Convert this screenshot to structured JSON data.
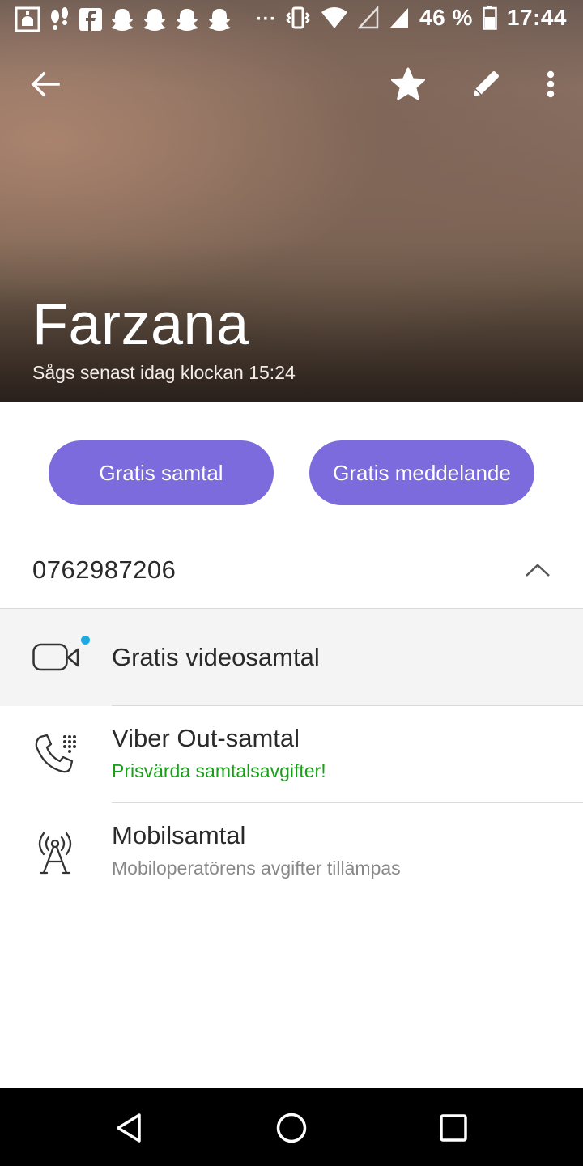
{
  "status_bar": {
    "battery_percent": "46 %",
    "time": "17:44",
    "overflow": "···"
  },
  "contact": {
    "name": "Farzana",
    "last_seen": "Sågs senast idag klockan 15:24"
  },
  "actions": {
    "free_call": "Gratis samtal",
    "free_message": "Gratis meddelande"
  },
  "phone_number": "0762987206",
  "options": [
    {
      "title": "Gratis videosamtal"
    },
    {
      "title": "Viber Out-samtal",
      "subtitle": "Prisvärda samtalsavgifter!"
    },
    {
      "title": "Mobilsamtal",
      "subtitle": "Mobiloperatörens avgifter tillämpas"
    }
  ],
  "colors": {
    "accent": "#7b6bdc",
    "promo_green": "#1a9e1a",
    "subtitle_gray": "#888888",
    "new_dot": "#1ea8e0"
  }
}
